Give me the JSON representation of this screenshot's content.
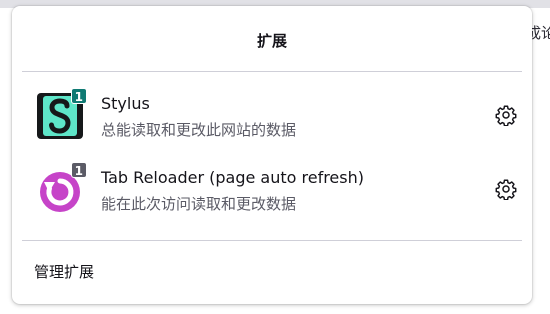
{
  "background": {
    "edge_text": "成论"
  },
  "panel": {
    "title": "扩展",
    "manage_label": "管理扩展"
  },
  "extensions": [
    {
      "name": "Stylus",
      "description": "总能读取和更改此网站的数据",
      "badge": "1",
      "badge_color": "#0f7a73",
      "icon": "stylus-icon"
    },
    {
      "name": "Tab Reloader (page auto refresh)",
      "description": "能在此次访问读取和更改数据",
      "badge": "1",
      "badge_color": "#5b5b66",
      "icon": "tab-reloader-icon"
    }
  ],
  "icons": {
    "settings": "gear-icon"
  },
  "colors": {
    "stylus_teal": "#5ee6c9",
    "tab_reloader_magenta": "#c644c8"
  }
}
